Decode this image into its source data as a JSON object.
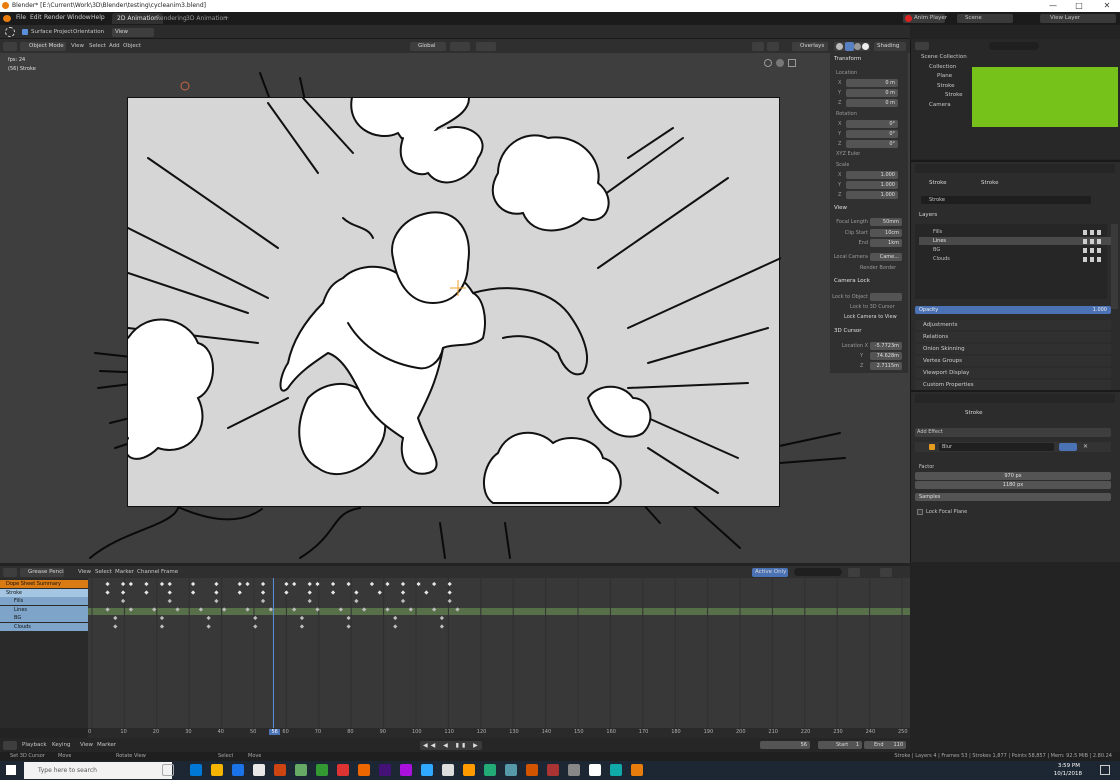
{
  "window": {
    "title": "Blender* [E:\\Current\\Work\\3D\\Blender\\testing\\cycleanim3.blend]",
    "controls": [
      "—",
      "□",
      "✕"
    ]
  },
  "menubar": {
    "items": [
      "File",
      "Edit",
      "Render",
      "Window",
      "Help"
    ],
    "workspaces": [
      "2D Animation",
      "Rendering",
      "3D Animation",
      "+"
    ],
    "active_workspace": "2D Animation",
    "anim_player": "Anim Player",
    "scene": "Scene",
    "view_layer": "View Layer"
  },
  "toolhdr": {
    "surface_project": "Surface Project",
    "orientation": "Orientation",
    "view": "View"
  },
  "viewhdr": {
    "mode": "Object Mode",
    "items": [
      "View",
      "Select",
      "Add",
      "Object"
    ],
    "transform": "Global",
    "overlays": "Overlays",
    "shading": "Shading"
  },
  "viewport": {
    "frame_label": "fps: 24",
    "object_label": "(56) Stroke"
  },
  "npanel": {
    "transform": "Transform",
    "location": "Location",
    "loc": [
      [
        "X",
        "0 m"
      ],
      [
        "Y",
        "0 m"
      ],
      [
        "Z",
        "0 m"
      ]
    ],
    "rotation": "Rotation",
    "rot": [
      [
        "X",
        "0°"
      ],
      [
        "Y",
        "0°"
      ],
      [
        "Z",
        "0°"
      ]
    ],
    "euler": "XYZ Euler",
    "scale": "Scale",
    "scl": [
      [
        "X",
        "1.000"
      ],
      [
        "Y",
        "1.000"
      ],
      [
        "Z",
        "1.000"
      ]
    ],
    "view": "View",
    "focal_length": [
      "Focal Length",
      "50mm"
    ],
    "clip_start": [
      "Clip Start",
      "10cm"
    ],
    "clip_end": [
      "End",
      "1km"
    ],
    "local_camera": [
      "Local Camera",
      "Came..."
    ],
    "render_border": "Render Border",
    "camera_lock": "Camera Lock",
    "lock_object": [
      "Lock to Object",
      ""
    ],
    "lock_cursor": "Lock to 3D Cursor",
    "lock_camera_view": "Lock Camera to View",
    "cursor": "3D Cursor",
    "cursor_loc": [
      [
        "Location X",
        "-5.7723m"
      ],
      [
        "Y",
        "74.628m"
      ],
      [
        "Z",
        "2.7115m"
      ]
    ]
  },
  "outliner": {
    "rows": [
      {
        "label": "Scene Collection",
        "indent": 0
      },
      {
        "label": "Collection",
        "indent": 1
      },
      {
        "label": "Plane",
        "indent": 2
      },
      {
        "label": "Stroke",
        "indent": 2
      },
      {
        "label": "Stroke",
        "indent": 3
      },
      {
        "label": "Camera",
        "indent": 1
      }
    ]
  },
  "props": {
    "breadcrumb": [
      "Stroke",
      "Stroke"
    ],
    "data_name": "Stroke",
    "layers_label": "Layers",
    "layers": [
      "Fills",
      "Lines",
      "BG",
      "Clouds"
    ],
    "active_layer": "Lines",
    "opacity": [
      "Opacity",
      "1.000"
    ],
    "panels": [
      "Adjustments",
      "Relations",
      "Onion Skinning",
      "Vertex Groups",
      "Viewport Display",
      "Custom Properties"
    ]
  },
  "effects": {
    "breadcrumb": "Stroke",
    "add_effect": "Add Effect",
    "effect_name": "Blur",
    "factor": "Factor",
    "factor_x": "970 px",
    "factor_y": "1180 px",
    "samples": "Samples",
    "lock_focal": "Lock Focal Plane"
  },
  "dopesheet": {
    "mode": "Grease Pencil",
    "items": [
      "View",
      "Select",
      "Marker",
      "Channel",
      "Frame"
    ],
    "active_only": "Active Only",
    "channels": [
      {
        "label": "Dope Sheet Summary",
        "color": "#d97a12"
      },
      {
        "label": "Stroke",
        "color": "#a5c6e2"
      },
      {
        "label": "Fills",
        "color": "#7ea5c9"
      },
      {
        "label": "Lines",
        "color": "#7ea5c9"
      },
      {
        "label": "BG",
        "color": "#7ea5c9"
      },
      {
        "label": "Clouds",
        "color": "#7ea5c9"
      }
    ],
    "ticks": [
      "0",
      "10",
      "20",
      "30",
      "40",
      "50",
      "56",
      "60",
      "70",
      "80",
      "90",
      "100",
      "110",
      "120",
      "130",
      "140",
      "150",
      "160",
      "170",
      "180",
      "190",
      "200",
      "210",
      "220",
      "230",
      "240",
      "250"
    ],
    "current_frame": 56,
    "frame_range": [
      0,
      250
    ]
  },
  "playback": {
    "items": [
      "Playback",
      "Keying",
      "View",
      "Marker"
    ],
    "current": "56",
    "start": "Start",
    "start_val": "1",
    "end": "End",
    "end_val": "110"
  },
  "status": {
    "left": [
      "Set 3D Cursor",
      "Move",
      "Rotate View",
      "Select",
      "Move"
    ],
    "right": "Stroke | Layers 4 | Frames 53 | Strokes 1,877 | Points 58,857 | Mem: 92.5 MiB | 2.80.24"
  },
  "taskbar": {
    "search_placeholder": "Type here to search",
    "time": "3:59 PM",
    "date": "10/1/2018"
  }
}
